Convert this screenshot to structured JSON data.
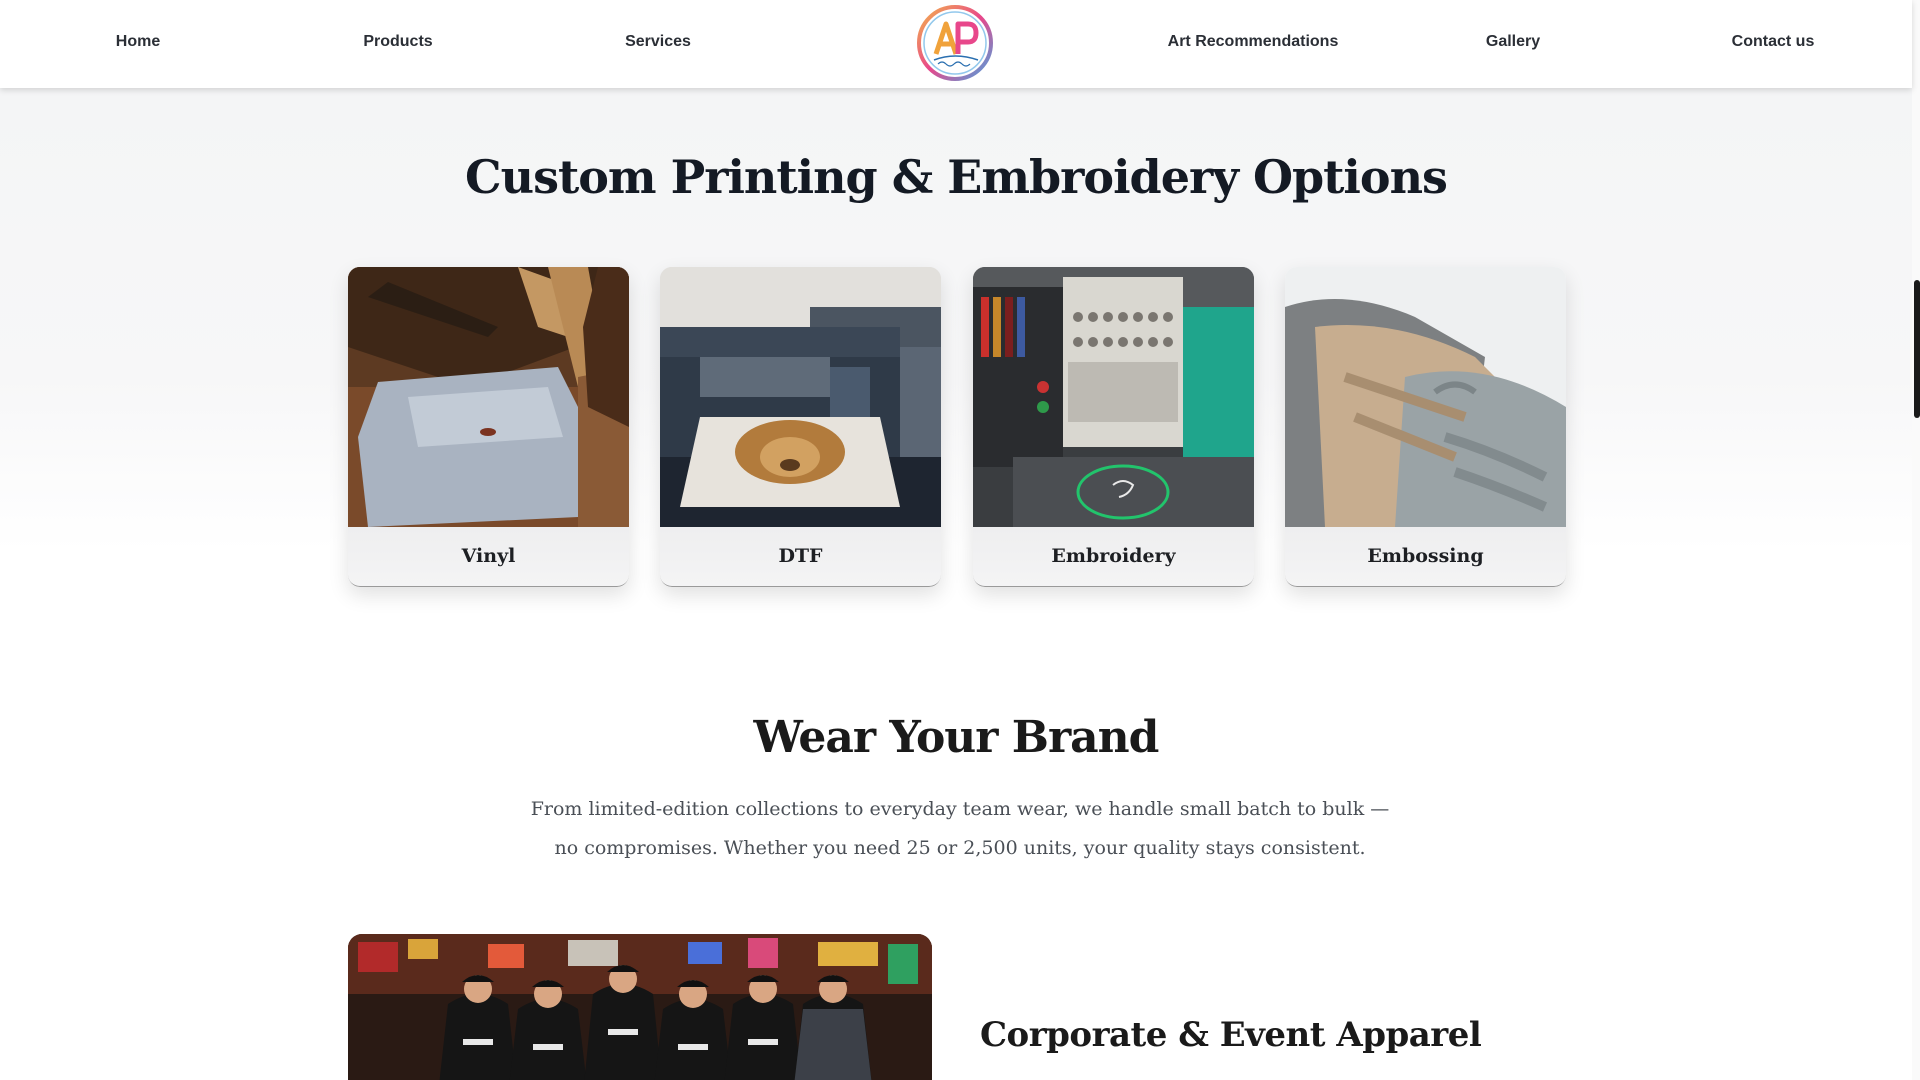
{
  "nav": {
    "items": [
      {
        "label": "Home"
      },
      {
        "label": "Products"
      },
      {
        "label": "Services"
      },
      {
        "label": "Art Recommendations"
      },
      {
        "label": "Gallery"
      },
      {
        "label": "Contact us"
      }
    ],
    "logo_icon": "ap-merchandise-logo"
  },
  "options": {
    "title": "Custom Printing & Embroidery Options",
    "cards": [
      {
        "label": "Vinyl",
        "image": "heat-press-vinyl-photo"
      },
      {
        "label": "DTF",
        "image": "dtf-printer-lion-shirt-photo"
      },
      {
        "label": "Embroidery",
        "image": "embroidery-machine-photo"
      },
      {
        "label": "Embossing",
        "image": "embossed-sweatshirts-photo"
      }
    ]
  },
  "brand": {
    "title": "Wear Your Brand",
    "text": "From limited-edition collections to everyday team wear, we handle small batch to bulk — no compromises. Whether you need 25 or 2,500 units, your quality stays consistent.",
    "photo": "team-in-matching-shirts-photo",
    "subtitle": "Corporate & Event Apparel"
  },
  "colors": {
    "heading": "#141a24",
    "nav_text": "#2b2f36",
    "body_text": "#4a4f56",
    "logo_pink": "#e8478b",
    "logo_blue": "#4aa3df",
    "logo_yellow": "#f3b44a"
  }
}
